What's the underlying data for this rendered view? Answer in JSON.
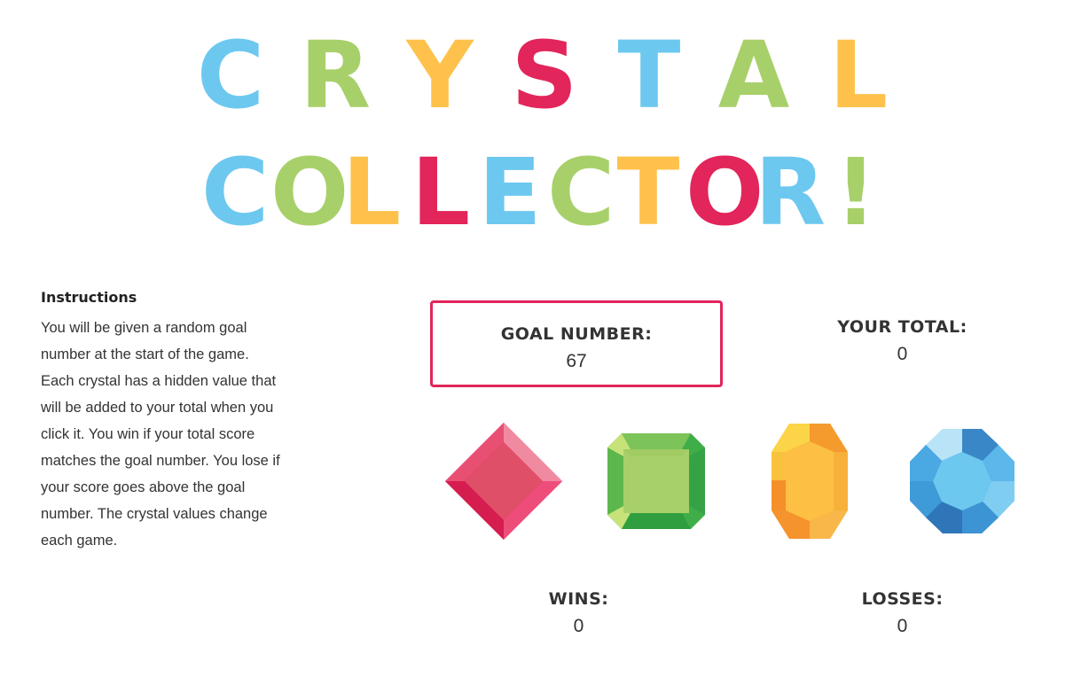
{
  "title": {
    "line1": [
      {
        "char": "C",
        "color": "#6dc8ef"
      },
      {
        "char": "R",
        "color": "#a8d06a"
      },
      {
        "char": "Y",
        "color": "#fec24c"
      },
      {
        "char": "S",
        "color": "#e2255a"
      },
      {
        "char": "T",
        "color": "#6dc8ef"
      },
      {
        "char": "A",
        "color": "#a8d06a"
      },
      {
        "char": "L",
        "color": "#fec24c"
      }
    ],
    "line2": [
      {
        "char": "C",
        "color": "#6dc8ef"
      },
      {
        "char": "O",
        "color": "#a8d06a"
      },
      {
        "char": "L",
        "color": "#fec24c"
      },
      {
        "char": "L",
        "color": "#e2255a"
      },
      {
        "char": "E",
        "color": "#6dc8ef"
      },
      {
        "char": "C",
        "color": "#a8d06a"
      },
      {
        "char": "T",
        "color": "#fec24c"
      },
      {
        "char": "O",
        "color": "#e2255a"
      },
      {
        "char": "R",
        "color": "#6dc8ef"
      },
      {
        "char": "!",
        "color": "#a8d06a"
      }
    ]
  },
  "instructions": {
    "heading": "Instructions",
    "body": "You will be given a random goal number at the start of the game. Each crystal has a hidden value that will be added to your total when you click it. You win if your total score matches the goal number. You lose if your score goes above the goal number. The crystal values change each game."
  },
  "goal": {
    "label": "GOAL NUMBER:",
    "value": "67"
  },
  "total": {
    "label": "YOUR TOTAL:",
    "value": "0"
  },
  "wins": {
    "label": "WINS:",
    "value": "0"
  },
  "losses": {
    "label": "LOSSES:",
    "value": "0"
  },
  "crystals": [
    {
      "name": "red-crystal",
      "icon": "red-diamond-gem-icon"
    },
    {
      "name": "green-crystal",
      "icon": "green-emerald-gem-icon"
    },
    {
      "name": "yellow-crystal",
      "icon": "yellow-hexagon-gem-icon"
    },
    {
      "name": "blue-crystal",
      "icon": "blue-round-gem-icon"
    }
  ],
  "colors": {
    "accent": "#e1255a",
    "blue": "#6dc8ef",
    "green": "#a8d06a",
    "yellow": "#fec24c",
    "red": "#e2255a"
  }
}
